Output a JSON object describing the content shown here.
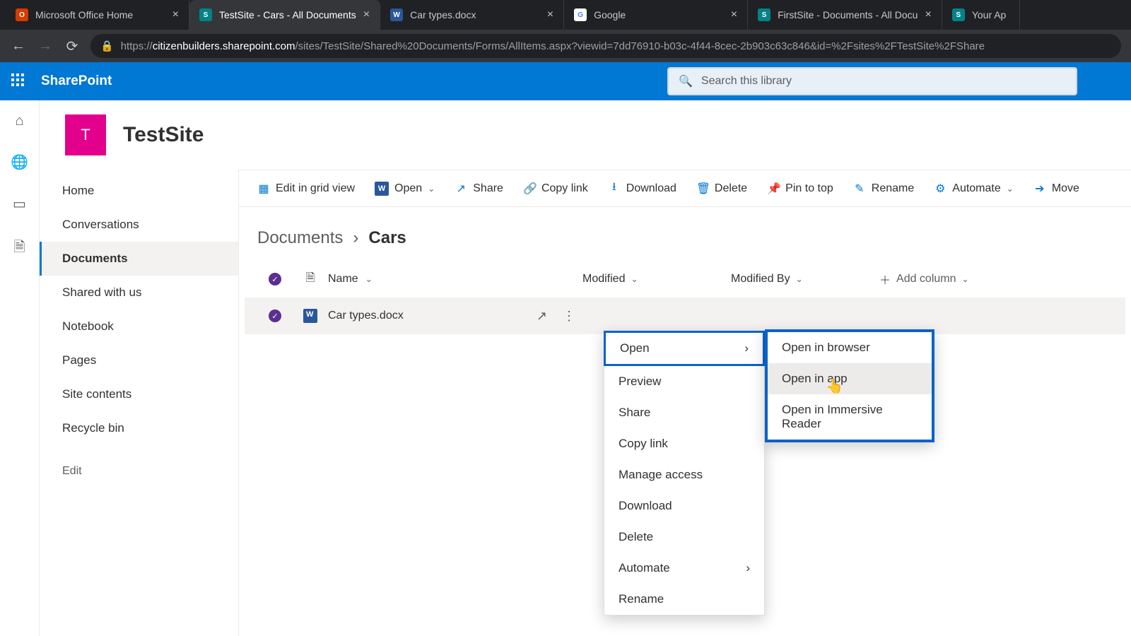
{
  "browser": {
    "tabs": [
      {
        "title": "Microsoft Office Home",
        "icon_bg": "#d83b01",
        "icon_text": "O",
        "active": false
      },
      {
        "title": "TestSite - Cars - All Documents",
        "icon_bg": "#038387",
        "icon_text": "S",
        "active": true
      },
      {
        "title": "Car types.docx",
        "icon_bg": "#2b579a",
        "icon_text": "W",
        "active": false
      },
      {
        "title": "Google",
        "icon_bg": "#ffffff",
        "icon_text": "G",
        "active": false
      },
      {
        "title": "FirstSite - Documents - All Docu",
        "icon_bg": "#038387",
        "icon_text": "S",
        "active": false
      },
      {
        "title": "Your Ap",
        "icon_bg": "#038387",
        "icon_text": "S",
        "active": false
      }
    ],
    "url_prefix": "https://",
    "url_domain": "citizenbuilders.sharepoint.com",
    "url_path": "/sites/TestSite/Shared%20Documents/Forms/AllItems.aspx?viewid=7dd76910-b03c-4f44-8cec-2b903c63c846&id=%2Fsites%2FTestSite%2FShare"
  },
  "suite": {
    "brand": "SharePoint",
    "search_placeholder": "Search this library"
  },
  "site": {
    "logo_letter": "T",
    "logo_bg": "#e3008c",
    "name": "TestSite"
  },
  "leftnav": {
    "items": [
      "Home",
      "Conversations",
      "Documents",
      "Shared with us",
      "Notebook",
      "Pages",
      "Site contents",
      "Recycle bin"
    ],
    "active_index": 2,
    "edit_label": "Edit"
  },
  "commands": {
    "edit_grid": "Edit in grid view",
    "open": "Open",
    "share": "Share",
    "copy_link": "Copy link",
    "download": "Download",
    "delete": "Delete",
    "pin": "Pin to top",
    "rename": "Rename",
    "automate": "Automate",
    "move": "Move"
  },
  "breadcrumb": {
    "root": "Documents",
    "current": "Cars"
  },
  "columns": {
    "name": "Name",
    "modified": "Modified",
    "modified_by": "Modified By",
    "add": "Add column"
  },
  "file": {
    "name": "Car types.docx"
  },
  "context_menu": {
    "items": [
      "Open",
      "Preview",
      "Share",
      "Copy link",
      "Manage access",
      "Download",
      "Delete",
      "Automate",
      "Rename"
    ],
    "submenu_parent": "Open",
    "submenu": [
      "Open in browser",
      "Open in app",
      "Open in Immersive Reader"
    ],
    "submenu_hover_index": 1
  }
}
